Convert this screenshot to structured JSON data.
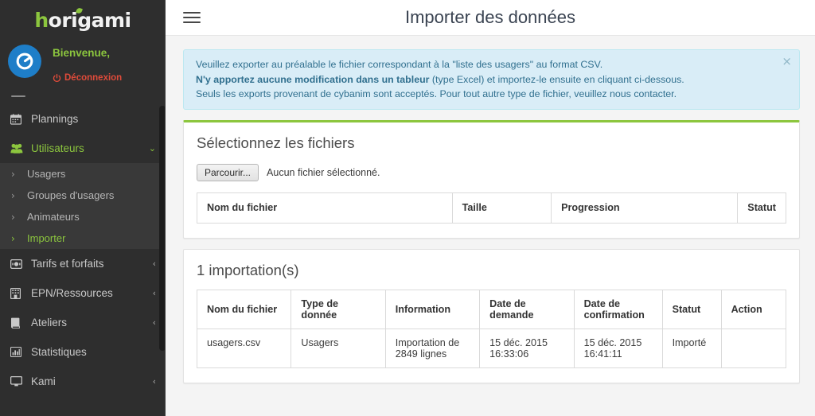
{
  "sidebar": {
    "brand": {
      "first": "h",
      "rest": "origami"
    },
    "user": {
      "welcome": "Bienvenue,",
      "logout": "Déconnexion"
    },
    "nav": [
      {
        "label": "Plannings",
        "icon": "calendar-icon",
        "caret": "",
        "green": false
      },
      {
        "label": "Utilisateurs",
        "icon": "users-icon",
        "caret": "⌄",
        "green": true
      },
      {
        "label": "Tarifs et forfaits",
        "icon": "money-icon",
        "caret": "‹",
        "green": false
      },
      {
        "label": "EPN/Ressources",
        "icon": "building-icon",
        "caret": "‹",
        "green": false
      },
      {
        "label": "Ateliers",
        "icon": "book-icon",
        "caret": "‹",
        "green": false
      },
      {
        "label": "Statistiques",
        "icon": "bar-chart-icon",
        "caret": "",
        "green": false
      },
      {
        "label": "Kami",
        "icon": "desktop-icon",
        "caret": "‹",
        "green": false
      }
    ],
    "submenu": [
      {
        "label": "Usagers",
        "active": false
      },
      {
        "label": "Groupes d'usagers",
        "active": false
      },
      {
        "label": "Animateurs",
        "active": false
      },
      {
        "label": "Importer",
        "active": true
      }
    ]
  },
  "header": {
    "title": "Importer des données",
    "menu_icon": "hamburger-icon"
  },
  "alert": {
    "line1": "Veuillez exporter au préalable le fichier correspondant à la \"liste des usagers\" au format CSV.",
    "line2_bold": "N'y apportez aucune modification dans un tableur",
    "line2_rest": " (type Excel) et importez-le ensuite en cliquant ci-dessous.",
    "line3": "Seuls les exports provenant de cybanim sont acceptés. Pour tout autre type de fichier, veuillez nous contacter.",
    "close_label": "×"
  },
  "select_files": {
    "title": "Sélectionnez les fichiers",
    "browse_label": "Parcourir...",
    "file_status": "Aucun fichier sélectionné.",
    "columns": [
      "Nom du fichier",
      "Taille",
      "Progression",
      "Statut"
    ],
    "rows": []
  },
  "imports": {
    "title": "1 importation(s)",
    "columns": [
      "Nom du fichier",
      "Type de donnée",
      "Information",
      "Date de demande",
      "Date de confirmation",
      "Statut",
      "Action"
    ],
    "rows": [
      {
        "filename": "usagers.csv",
        "type": "Usagers",
        "information": "Importation de 2849 lignes",
        "request_date": "15 déc. 2015 16:33:06",
        "confirm_date": "15 déc. 2015 16:41:11",
        "status": "Importé",
        "action": ""
      }
    ]
  },
  "colors": {
    "accent_green": "#8cc63e",
    "sidebar_bg": "#2e2e2e",
    "alert_bg": "#d9edf7",
    "alert_text": "#31708f",
    "logout_red": "#e04b3a",
    "avatar_blue": "#1e7ec8"
  }
}
